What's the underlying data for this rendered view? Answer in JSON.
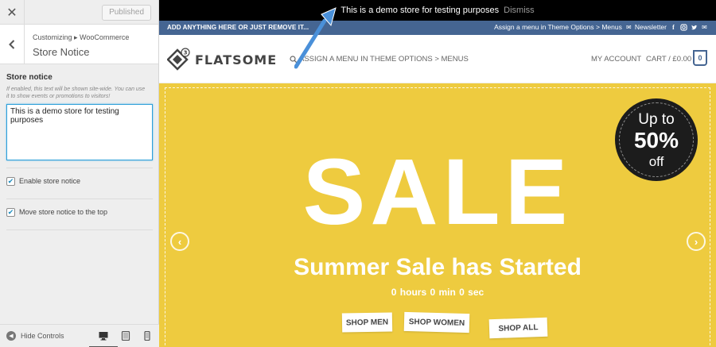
{
  "customizer": {
    "published_label": "Published",
    "breadcrumb": "Customizing ▸ WooCommerce",
    "section_title": "Store Notice",
    "field_label": "Store notice",
    "field_description": "If enabled, this text will be shown site-wide. You can use it to show events or promotions to visitors!",
    "notice_text": "This is a demo store for testing purposes",
    "checkboxes": [
      {
        "label": "Enable store notice",
        "checked": true
      },
      {
        "label": "Move store notice to the top",
        "checked": true
      }
    ],
    "hide_controls_label": "Hide Controls",
    "accent_color": "#2d9fd9"
  },
  "preview": {
    "notice": {
      "text": "This is a demo store for testing purposes",
      "dismiss": "Dismiss"
    },
    "topbar": {
      "left": "ADD ANYTHING HERE OR JUST REMOVE IT...",
      "menu_hint": "Assign a menu in Theme Options > Menus",
      "newsletter": "Newsletter",
      "social_icons": [
        "mail-icon",
        "facebook-icon",
        "instagram-icon",
        "twitter-icon",
        "email-icon"
      ],
      "bg_color": "#456592"
    },
    "header": {
      "logo_text": "FLATSOME",
      "logo_badge": "3",
      "nav_text": "ASSIGN A MENU IN THEME OPTIONS > MENUS",
      "account": "MY ACCOUNT",
      "cart": "CART / £0.00",
      "cart_count": "0"
    },
    "banner": {
      "bg_color": "#eecb3f",
      "badge_up": "Up to",
      "badge_pct": "50%",
      "badge_off": "off",
      "headline": "SALE",
      "subtitle": "Summer Sale has Started",
      "countdown": "0 hours  0 min  0 sec",
      "buttons": [
        "SHOP MEN",
        "SHOP WOMEN",
        "SHOP ALL"
      ]
    }
  }
}
